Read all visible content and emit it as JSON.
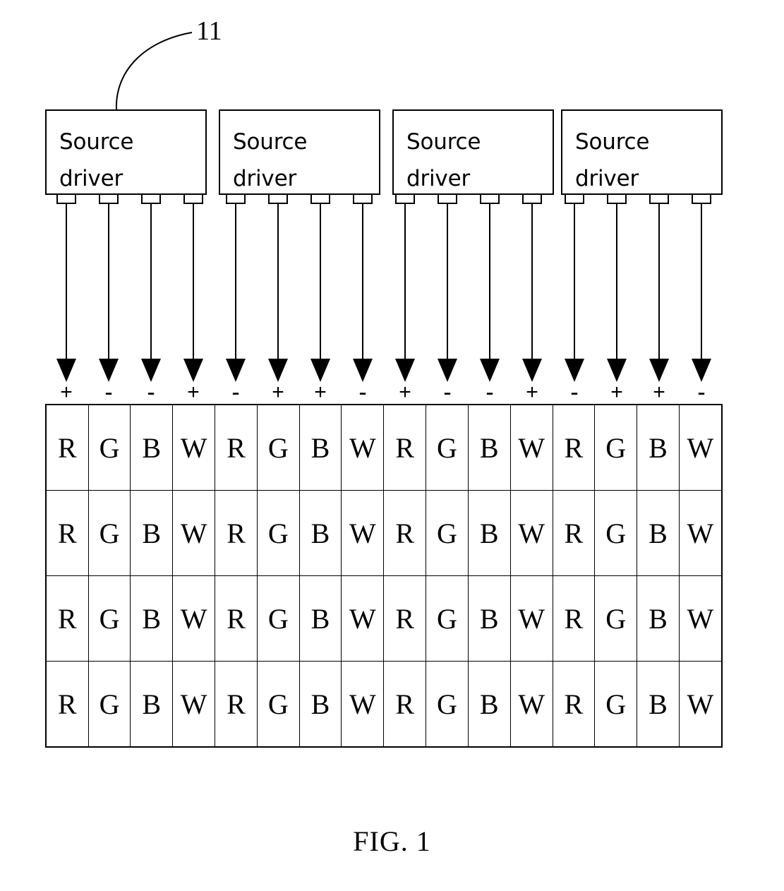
{
  "figure": {
    "caption": "FIG. 1",
    "reference_label": "11"
  },
  "drivers": {
    "label": "Source\ndriver",
    "count": 4,
    "outputs_per_driver": 4,
    "items": [
      {
        "label": "Source\ndriver"
      },
      {
        "label": "Source\ndriver"
      },
      {
        "label": "Source\ndriver"
      },
      {
        "label": "Source\ndriver"
      }
    ]
  },
  "polarities": [
    "+",
    "-",
    "-",
    "+",
    "-",
    "+",
    "+",
    "-",
    "+",
    "-",
    "-",
    "+",
    "-",
    "+",
    "+",
    "-"
  ],
  "pixel_grid": {
    "columns": 16,
    "rows": 4,
    "subpixel_pattern": [
      "R",
      "G",
      "B",
      "W"
    ],
    "cells": [
      [
        "R",
        "G",
        "B",
        "W",
        "R",
        "G",
        "B",
        "W",
        "R",
        "G",
        "B",
        "W",
        "R",
        "G",
        "B",
        "W"
      ],
      [
        "R",
        "G",
        "B",
        "W",
        "R",
        "G",
        "B",
        "W",
        "R",
        "G",
        "B",
        "W",
        "R",
        "G",
        "B",
        "W"
      ],
      [
        "R",
        "G",
        "B",
        "W",
        "R",
        "G",
        "B",
        "W",
        "R",
        "G",
        "B",
        "W",
        "R",
        "G",
        "B",
        "W"
      ],
      [
        "R",
        "G",
        "B",
        "W",
        "R",
        "G",
        "B",
        "W",
        "R",
        "G",
        "B",
        "W",
        "R",
        "G",
        "B",
        "W"
      ]
    ]
  },
  "colors": {
    "line": "#000000",
    "background": "#ffffff",
    "text": "#000000"
  }
}
